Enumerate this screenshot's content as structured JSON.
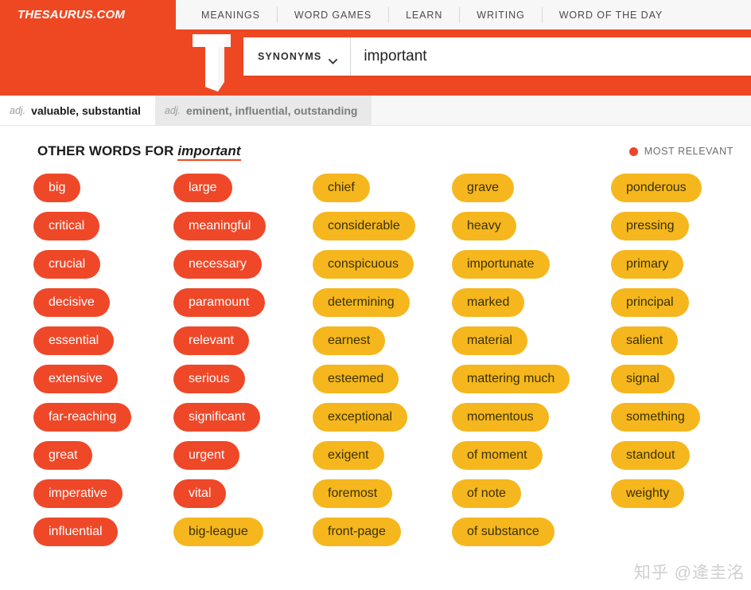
{
  "header": {
    "brand": "THESAURUS.COM",
    "nav_items": [
      {
        "label": "MEANINGS"
      },
      {
        "label": "WORD GAMES"
      },
      {
        "label": "LEARN"
      },
      {
        "label": "WRITING"
      },
      {
        "label": "WORD OF THE DAY"
      }
    ]
  },
  "search": {
    "logo_icon": "thesaurus-t-logo-icon",
    "mode_label": "SYNONYMS",
    "chevron_icon": "chevron-down-icon",
    "query": "important",
    "placeholder": "important"
  },
  "pos_tabs": [
    {
      "pos": "adj.",
      "words": "valuable, substantial",
      "active": true
    },
    {
      "pos": "adj.",
      "words": "eminent, influential, outstanding",
      "active": false
    }
  ],
  "panel": {
    "title_prefix": "OTHER WORDS FOR",
    "title_word": "important",
    "legend_dot_icon": "relevance-dot-icon",
    "legend_label": "MOST RELEVANT"
  },
  "colors": {
    "brand_red": "#ee4823",
    "chip_red": "#ee4829",
    "chip_yellow": "#f5b71d",
    "nav_bg": "#f7f7f7",
    "tab_inactive_bg": "#e9e9e9"
  },
  "columns": [
    {
      "words": [
        {
          "text": "big",
          "relevance": "red"
        },
        {
          "text": "critical",
          "relevance": "red"
        },
        {
          "text": "crucial",
          "relevance": "red"
        },
        {
          "text": "decisive",
          "relevance": "red"
        },
        {
          "text": "essential",
          "relevance": "red"
        },
        {
          "text": "extensive",
          "relevance": "red"
        },
        {
          "text": "far-reaching",
          "relevance": "red"
        },
        {
          "text": "great",
          "relevance": "red"
        },
        {
          "text": "imperative",
          "relevance": "red"
        },
        {
          "text": "influential",
          "relevance": "red"
        }
      ]
    },
    {
      "words": [
        {
          "text": "large",
          "relevance": "red"
        },
        {
          "text": "meaningful",
          "relevance": "red"
        },
        {
          "text": "necessary",
          "relevance": "red"
        },
        {
          "text": "paramount",
          "relevance": "red"
        },
        {
          "text": "relevant",
          "relevance": "red"
        },
        {
          "text": "serious",
          "relevance": "red"
        },
        {
          "text": "significant",
          "relevance": "red"
        },
        {
          "text": "urgent",
          "relevance": "red"
        },
        {
          "text": "vital",
          "relevance": "red"
        },
        {
          "text": "big-league",
          "relevance": "yellow"
        }
      ]
    },
    {
      "words": [
        {
          "text": "chief",
          "relevance": "yellow"
        },
        {
          "text": "considerable",
          "relevance": "yellow"
        },
        {
          "text": "conspicuous",
          "relevance": "yellow"
        },
        {
          "text": "determining",
          "relevance": "yellow"
        },
        {
          "text": "earnest",
          "relevance": "yellow"
        },
        {
          "text": "esteemed",
          "relevance": "yellow"
        },
        {
          "text": "exceptional",
          "relevance": "yellow"
        },
        {
          "text": "exigent",
          "relevance": "yellow"
        },
        {
          "text": "foremost",
          "relevance": "yellow"
        },
        {
          "text": "front-page",
          "relevance": "yellow"
        }
      ]
    },
    {
      "words": [
        {
          "text": "grave",
          "relevance": "yellow"
        },
        {
          "text": "heavy",
          "relevance": "yellow"
        },
        {
          "text": "importunate",
          "relevance": "yellow"
        },
        {
          "text": "marked",
          "relevance": "yellow"
        },
        {
          "text": "material",
          "relevance": "yellow"
        },
        {
          "text": "mattering much",
          "relevance": "yellow"
        },
        {
          "text": "momentous",
          "relevance": "yellow"
        },
        {
          "text": "of moment",
          "relevance": "yellow"
        },
        {
          "text": "of note",
          "relevance": "yellow"
        },
        {
          "text": "of substance",
          "relevance": "yellow"
        }
      ]
    },
    {
      "words": [
        {
          "text": "ponderous",
          "relevance": "yellow"
        },
        {
          "text": "pressing",
          "relevance": "yellow"
        },
        {
          "text": "primary",
          "relevance": "yellow"
        },
        {
          "text": "principal",
          "relevance": "yellow"
        },
        {
          "text": "salient",
          "relevance": "yellow"
        },
        {
          "text": "signal",
          "relevance": "yellow"
        },
        {
          "text": "something",
          "relevance": "yellow"
        },
        {
          "text": "standout",
          "relevance": "yellow"
        },
        {
          "text": "weighty",
          "relevance": "yellow"
        }
      ]
    }
  ],
  "watermark": {
    "text": "知乎 @逄圭洺"
  }
}
